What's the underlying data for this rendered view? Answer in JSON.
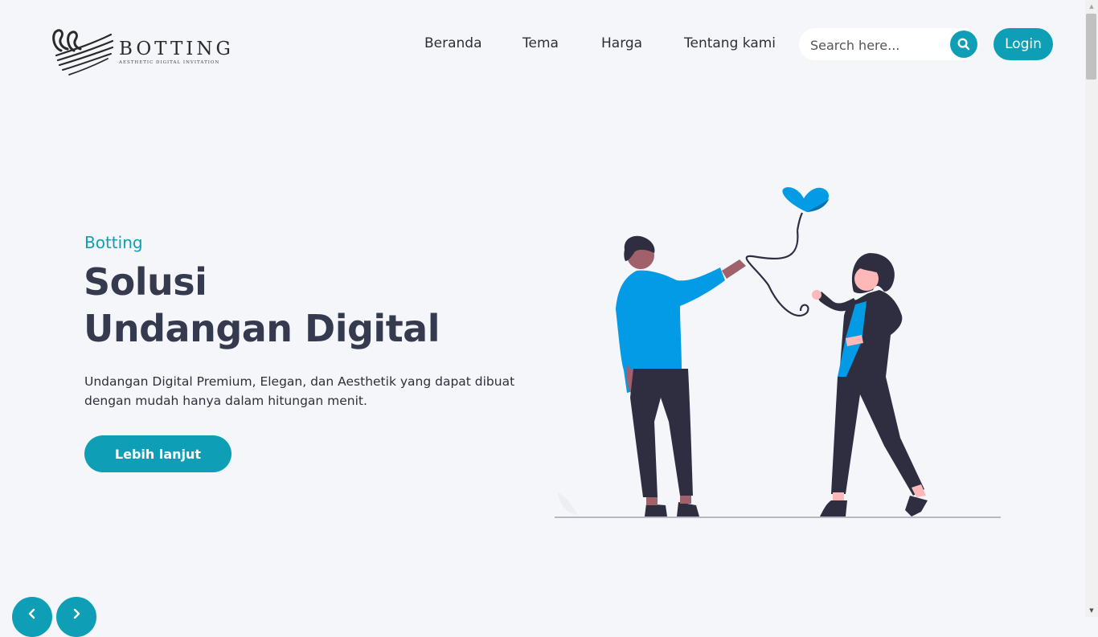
{
  "logo": {
    "name": "BOTTING",
    "tagline": "AESTHETIC DIGITAL INVITATION"
  },
  "nav": {
    "links": [
      "Beranda",
      "Tema",
      "Harga",
      "Tentang kami"
    ],
    "search_placeholder": "Search here...",
    "search_icon": "search-icon",
    "login_label": "Login"
  },
  "hero": {
    "subtitle": "Botting",
    "title_line1": "Solusi",
    "title_line2": "Undangan Digital",
    "description": "Undangan Digital Premium, Elegan, dan Aesthetik yang dapat dibuat dengan mudah hanya dalam hitungan menit.",
    "cta_label": "Lebih lanjut"
  },
  "carousel": {
    "prev_icon": "chevron-left-icon",
    "next_icon": "chevron-right-icon"
  },
  "colors": {
    "accent": "#0e9fb7",
    "heading": "#353a4e",
    "background": "#f4f6fa",
    "illustration_blue": "#039be5",
    "illustration_dark": "#2f2e41"
  }
}
